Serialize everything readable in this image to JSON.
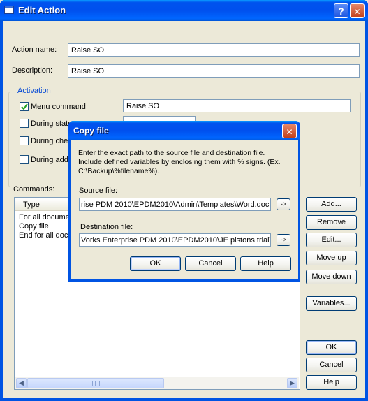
{
  "window": {
    "title": "Edit Action",
    "help_glyph": "?",
    "close_glyph": "✕"
  },
  "form": {
    "action_name_label": "Action name:",
    "action_name_value": "Raise SO",
    "description_label": "Description:",
    "description_value": "Raise SO"
  },
  "activation": {
    "legend": "Activation",
    "menu_command_label": "Menu command",
    "menu_command_checked": true,
    "menu_command_value": "Raise SO",
    "during_state_label": "During state",
    "during_check_label": "During chec",
    "during_add_label": "During add"
  },
  "commands": {
    "label": "Commands:",
    "column_header": "Type",
    "rows": [
      "For all docume",
      "Copy file",
      "End for all docu"
    ]
  },
  "side_buttons": {
    "add": "Add...",
    "remove": "Remove",
    "edit": "Edit...",
    "move_up": "Move up",
    "move_down": "Move down",
    "variables": "Variables..."
  },
  "bottom_buttons": {
    "ok": "OK",
    "cancel": "Cancel",
    "help": "Help"
  },
  "dialog": {
    "title": "Copy file",
    "close_glyph": "✕",
    "instructions": "Enter the exact path to the source file and destination file. Include defined variables by enclosing them with % signs. (Ex. C:\\Backup\\%filename%).",
    "source_label": "Source file:",
    "source_value": "rise PDM 2010\\EPDM2010\\Admin\\Templates\\Word.doc",
    "dest_label": "Destination file:",
    "dest_value": "Vorks Enterprise PDM 2010\\EPDM2010\\JE pistons trial\\",
    "arrow_label": "->",
    "ok": "OK",
    "cancel": "Cancel",
    "help": "Help"
  },
  "colors": {
    "title_blue": "#0054e3",
    "group_legend": "#0046d5",
    "close_red": "#c3401c",
    "face": "#ece9d8"
  }
}
